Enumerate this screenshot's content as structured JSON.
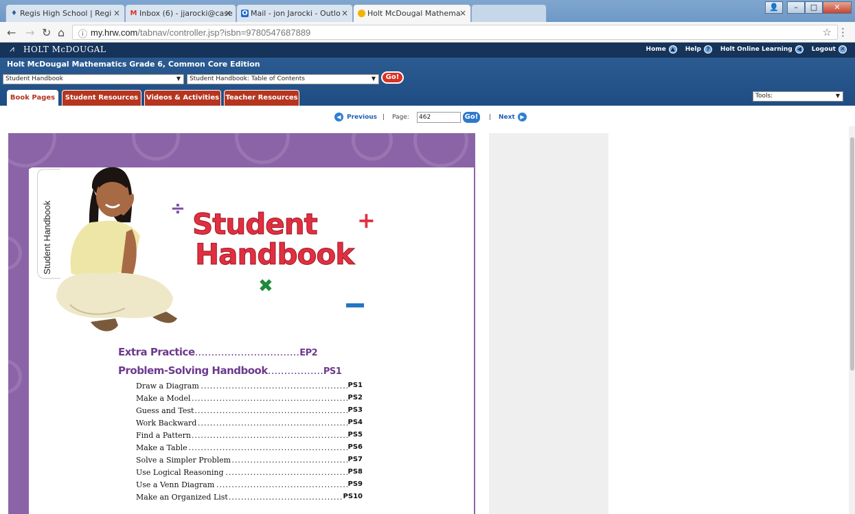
{
  "browser": {
    "tabs": [
      {
        "title": "Regis High School | Regi",
        "icon": "regis-shield-icon"
      },
      {
        "title": "Inbox (6) - jjarocki@case",
        "icon": "gmail-icon"
      },
      {
        "title": "Mail - jon Jarocki - Outlo",
        "icon": "outlook-icon"
      },
      {
        "title": "Holt McDougal Mathema",
        "icon": "holt-circle-icon"
      }
    ],
    "url_host": "my.hrw.com",
    "url_path": "/tabnav/controller.jsp?isbn=9780547687889"
  },
  "header": {
    "logo": "HOLT McDOUGAL",
    "nav": [
      {
        "label": "Home",
        "icon": "home-icon",
        "glyph": "▲"
      },
      {
        "label": "Help",
        "icon": "help-icon",
        "glyph": "?"
      },
      {
        "label": "Holt Online Learning",
        "icon": "back-arrow-icon",
        "glyph": "◀"
      },
      {
        "label": "Logout",
        "icon": "logout-x-icon",
        "glyph": "✕"
      }
    ]
  },
  "toolbar": {
    "book_title": "Holt McDougal Mathematics Grade 6, Common Core Edition",
    "section_select": "Student Handbook",
    "toc_select": "Student Handbook: Table of Contents",
    "go_label": "Go!",
    "tools_select": "Tools:"
  },
  "book_tabs": [
    "Book Pages",
    "Student Resources",
    "Videos & Activities",
    "Teacher Resources"
  ],
  "pager": {
    "previous": "Previous",
    "page_label": "Page:",
    "page_value": "462",
    "go": "Go!",
    "next": "Next",
    "separator": "|"
  },
  "page": {
    "side_tab": "Student Handbook",
    "title_line1": "Student",
    "title_line2": "Handbook",
    "main_entries": [
      {
        "label": "Extra Practice",
        "dots": "................................",
        "page": "EP2"
      },
      {
        "label": "Problem-Solving Handbook",
        "dots": ".................",
        "page": "PS1"
      }
    ],
    "sub_entries": [
      {
        "label": "Draw a Diagram",
        "page": "PS1"
      },
      {
        "label": "Make a Model",
        "page": "PS2"
      },
      {
        "label": "Guess and Test",
        "page": "PS3"
      },
      {
        "label": "Work Backward",
        "page": "PS4"
      },
      {
        "label": "Find a Pattern",
        "page": "PS5"
      },
      {
        "label": "Make a Table",
        "page": "PS6"
      },
      {
        "label": "Solve a Simpler Problem",
        "page": "PS7"
      },
      {
        "label": "Use Logical Reasoning",
        "page": "PS8"
      },
      {
        "label": "Use a Venn Diagram",
        "page": "PS9"
      },
      {
        "label": "Make an Organized List",
        "page": "PS10"
      }
    ],
    "leader_dots": "................................................................................................................",
    "colors": {
      "purple": "#8b64a8",
      "title_red": "#e03040",
      "toc_purple": "#6d3a8e"
    }
  }
}
